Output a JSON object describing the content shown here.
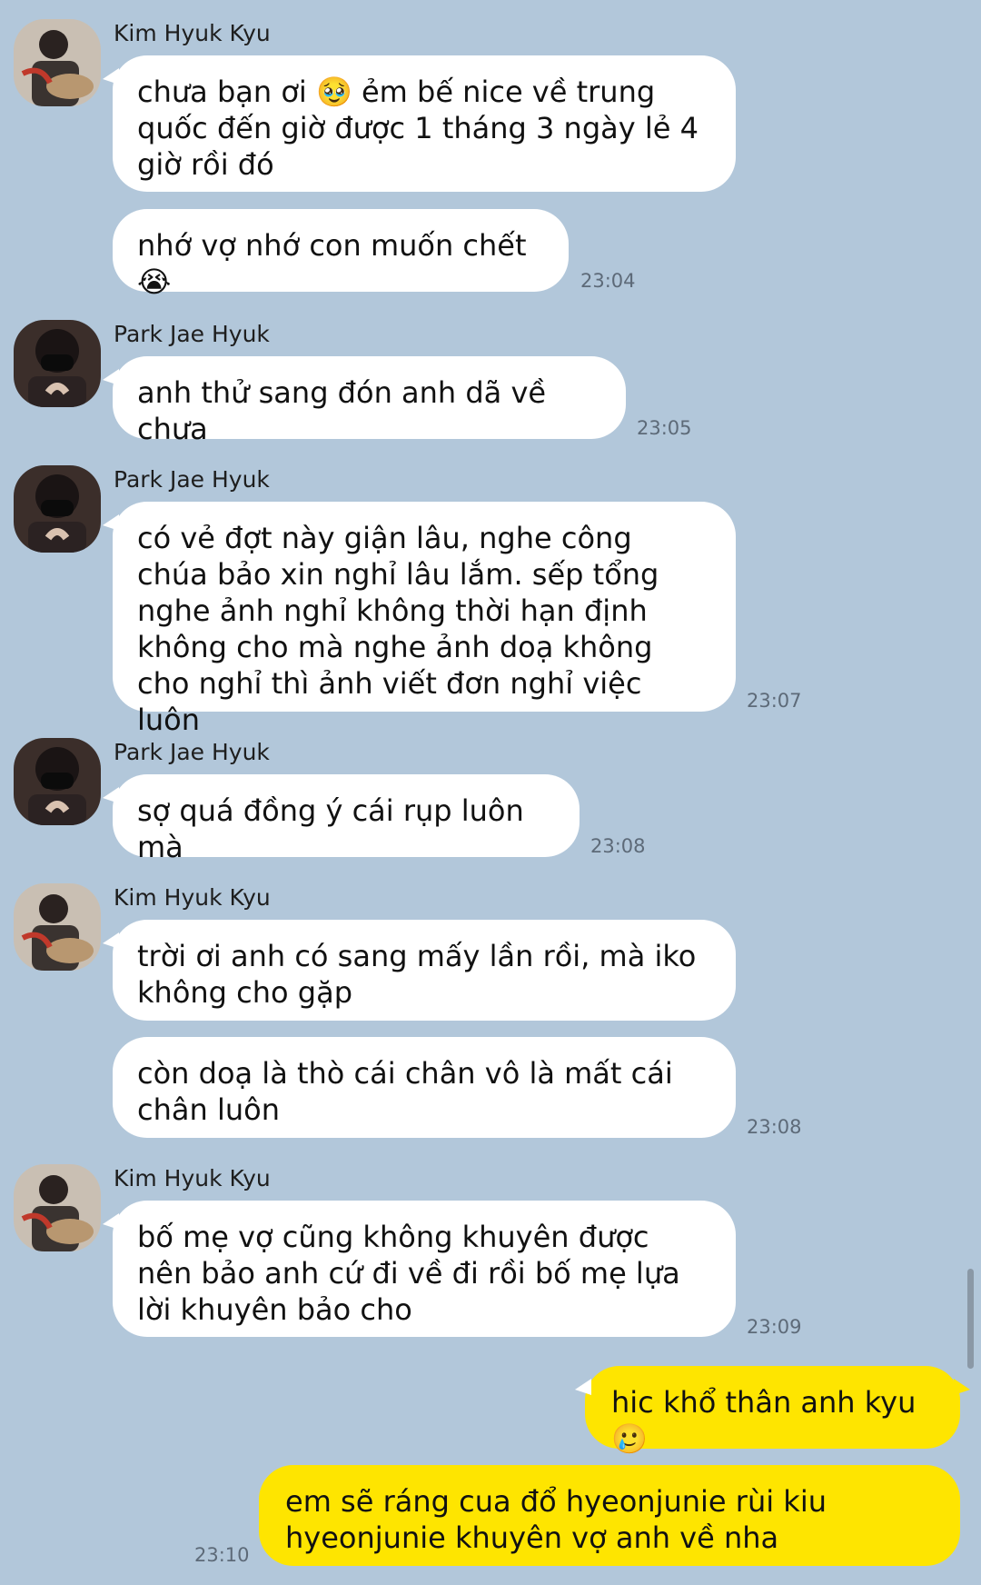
{
  "messages": [
    {
      "sender": "Kim Hyuk Kyu",
      "text": "chưa bạn ơi 🥹 ẻm bế nice về trung quốc đến giờ được 1 tháng 3 ngày lẻ 4 giờ rồi đó"
    },
    {
      "sender": "Kim Hyuk Kyu",
      "text": "nhớ vợ nhớ con muốn chết 😭",
      "time": "23:04"
    },
    {
      "sender": "Park Jae Hyuk",
      "text": "anh thử sang đón anh dã về chưa",
      "time": "23:05"
    },
    {
      "sender": "Park Jae Hyuk",
      "text": "có vẻ đợt này giận lâu, nghe công chúa bảo xin nghỉ lâu lắm. sếp tổng nghe ảnh nghỉ không thời hạn định không cho mà nghe ảnh doạ không cho nghỉ thì ảnh viết đơn nghỉ việc luôn",
      "time": "23:07"
    },
    {
      "sender": "Park Jae Hyuk",
      "text": "sợ quá đồng ý cái rụp luôn mà",
      "time": "23:08"
    },
    {
      "sender": "Kim Hyuk Kyu",
      "text": "trời ơi anh có sang mấy lần rồi, mà iko không cho gặp"
    },
    {
      "sender": "Kim Hyuk Kyu",
      "text": "còn doạ là thò cái chân vô là mất cái chân luôn",
      "time": "23:08"
    },
    {
      "sender": "Kim Hyuk Kyu",
      "text": "bố mẹ vợ cũng không khuyên được nên bảo anh cứ đi về đi rồi bố mẹ lựa lời khuyên bảo cho",
      "time": "23:09"
    },
    {
      "sender": "me",
      "text": "hic khổ thân anh kyu 🥲"
    },
    {
      "sender": "me",
      "text": "em sẽ ráng cua đổ hyeonjunie rùi kiu hyeonjunie khuyên vợ anh về nha",
      "time": "23:10"
    }
  ],
  "colors": {
    "background": "#b2c7da",
    "incoming": "#ffffff",
    "outgoing": "#fee500"
  }
}
